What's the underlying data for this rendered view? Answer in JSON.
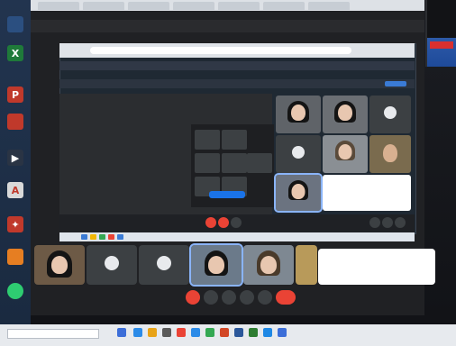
{
  "window": {
    "title": ""
  },
  "share": {
    "address_text": "",
    "banner_text": "",
    "banner2_text": "",
    "caption_left": "",
    "present_button_label": ""
  },
  "participants": [
    {
      "name": ""
    },
    {
      "name": ""
    },
    {
      "name": ""
    },
    {
      "name": ""
    },
    {
      "name": ""
    },
    {
      "name": ""
    },
    {
      "name": ""
    },
    {
      "name": ""
    }
  ],
  "chat_popup": {
    "sender": "",
    "line1": "",
    "line2": ""
  },
  "meeting": {
    "code": ""
  },
  "taskbar": {
    "search_placeholder": ""
  },
  "inset": {
    "label": "",
    "sign_text": ""
  },
  "colors": {
    "meet_bg": "#202124",
    "accent_blue": "#8ab4f8",
    "end_call_red": "#ea4335"
  },
  "icons": [
    "chrome-icon",
    "excel-icon",
    "powerpoint-icon",
    "pdf-icon",
    "line-icon",
    "mic-icon",
    "camera-icon",
    "captions-icon",
    "present-icon",
    "more-icon",
    "end-call-icon",
    "info-icon",
    "people-icon",
    "chat-icon",
    "activities-icon"
  ]
}
